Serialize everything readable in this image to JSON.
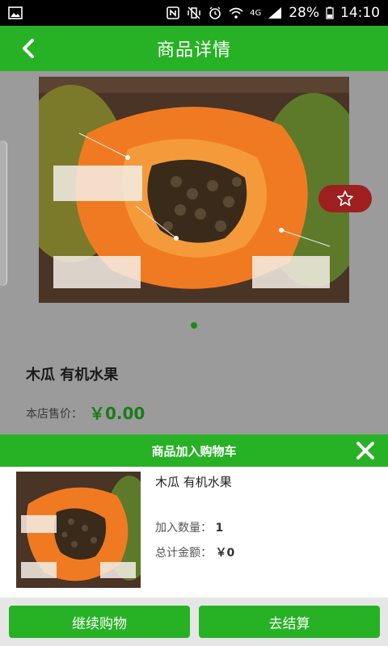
{
  "status_bar": {
    "battery": "28%",
    "time": "14:10",
    "network": "4G"
  },
  "header": {
    "title": "商品详情"
  },
  "product": {
    "name": "木瓜 有机水果",
    "price_label": "本店售价：",
    "price_value": "￥0.00"
  },
  "cart": {
    "title": "商品加入购物车",
    "item_name": "木瓜 有机水果",
    "qty_label": "加入数量：",
    "qty_value": "1",
    "total_label": "总计金额：",
    "total_value": "￥0"
  },
  "buttons": {
    "continue": "继续购物",
    "checkout": "去结算"
  },
  "colors": {
    "brand": "#27b125",
    "price": "#1c7a1a",
    "favorite": "#9e1f1f"
  }
}
